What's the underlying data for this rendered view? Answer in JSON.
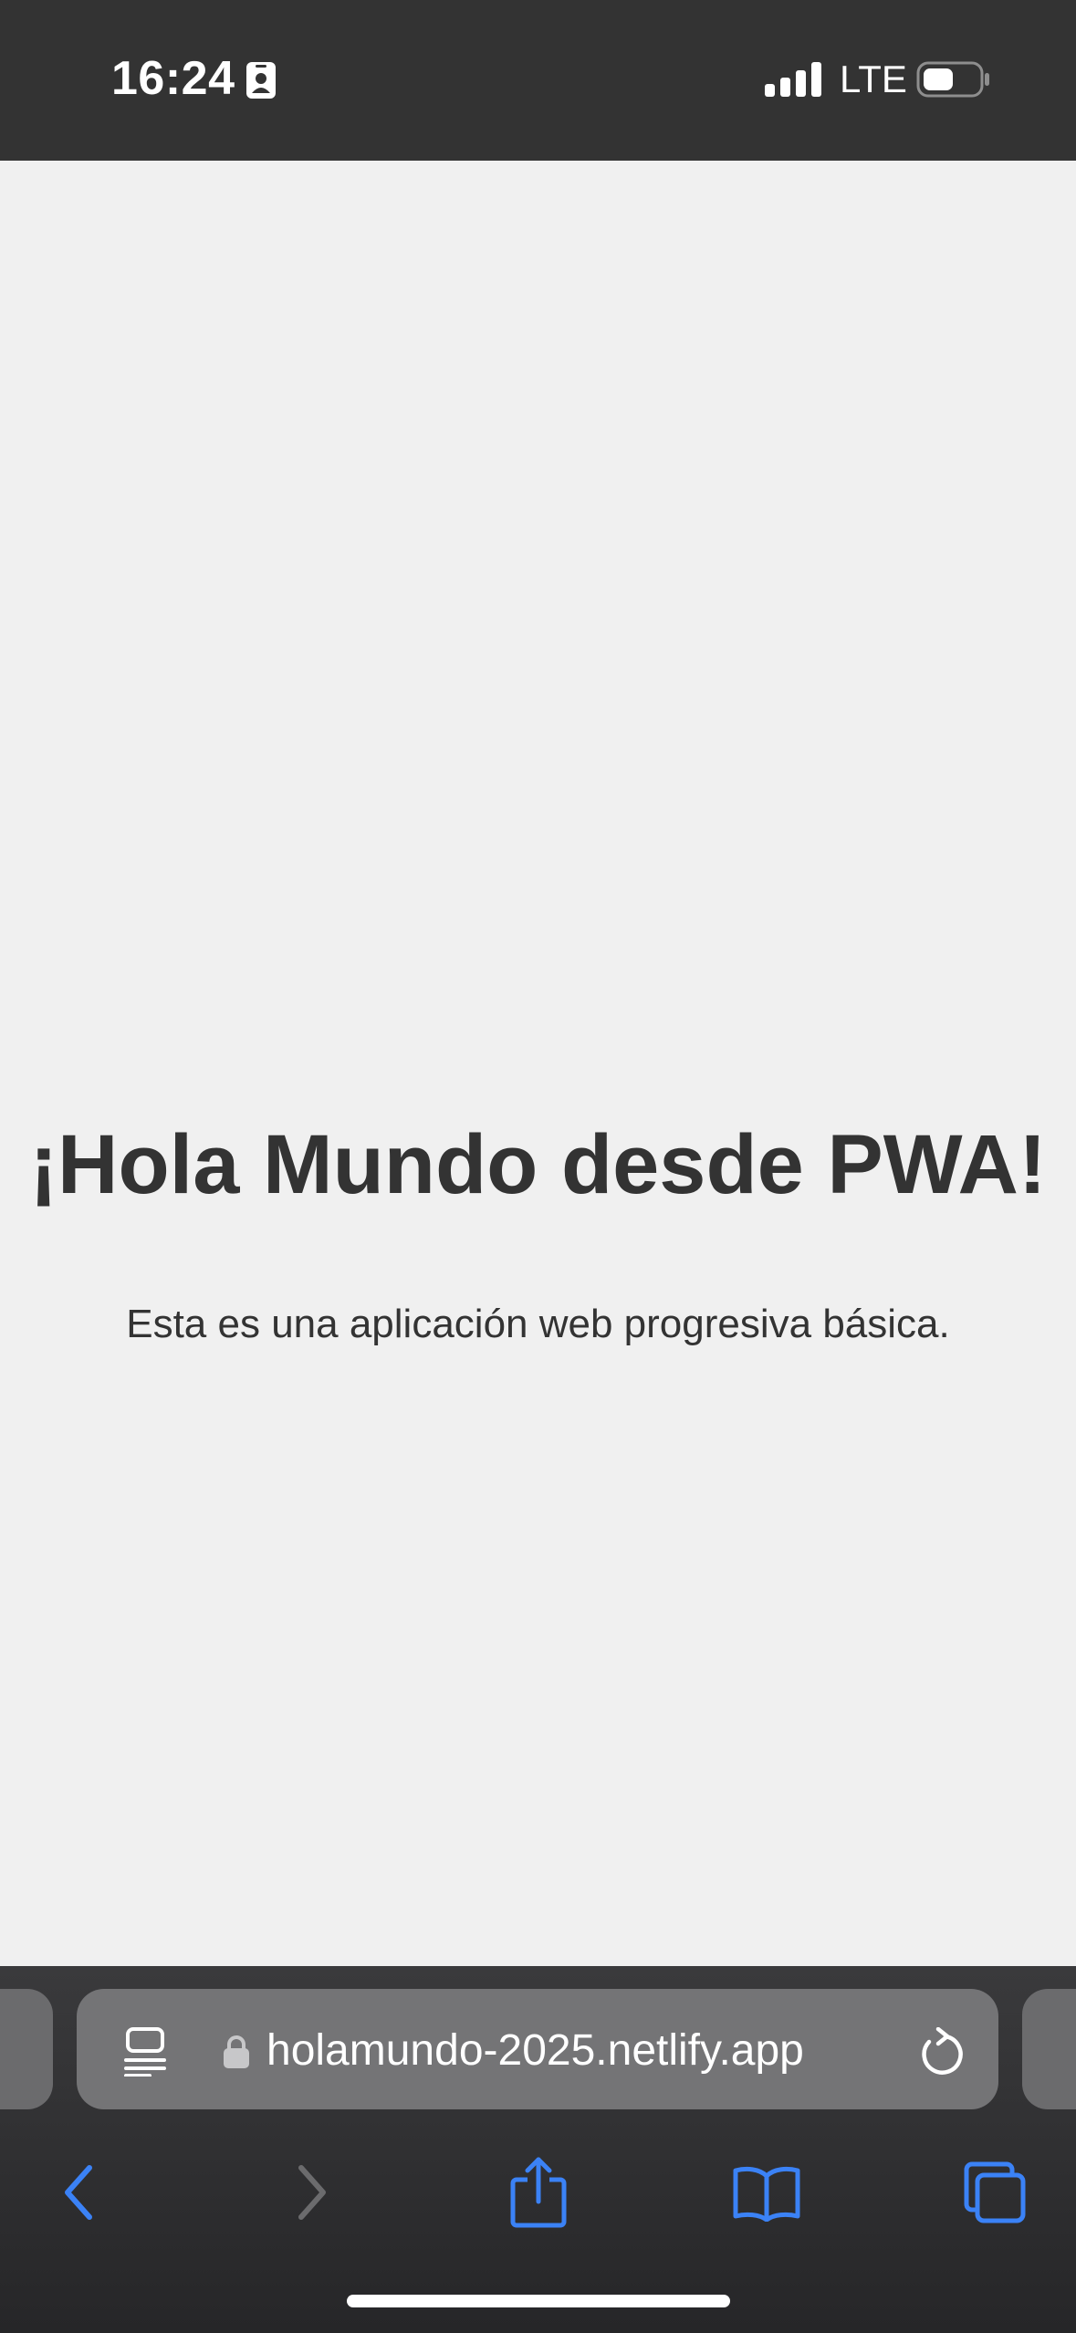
{
  "status_bar": {
    "time": "16:24",
    "network": "LTE",
    "icons": [
      "id-card-icon",
      "signal-icon",
      "battery-icon"
    ]
  },
  "page": {
    "heading": "¡Hola Mundo desde PWA!",
    "paragraph": "Esta es una aplicación web progresiva básica."
  },
  "browser": {
    "url": "holamundo-2025.netlify.app",
    "icons": [
      "reader-icon",
      "lock-icon",
      "reload-icon"
    ],
    "toolbar": [
      "back-icon",
      "forward-icon",
      "share-icon",
      "bookmarks-icon",
      "tabs-icon"
    ]
  },
  "colors": {
    "status_bar_bg": "#333333",
    "page_bg": "#f0f0f0",
    "text": "#333333",
    "accent": "#3b82f6",
    "address_bar_bg": "#747476",
    "disabled_icon": "#6b6b6d"
  }
}
